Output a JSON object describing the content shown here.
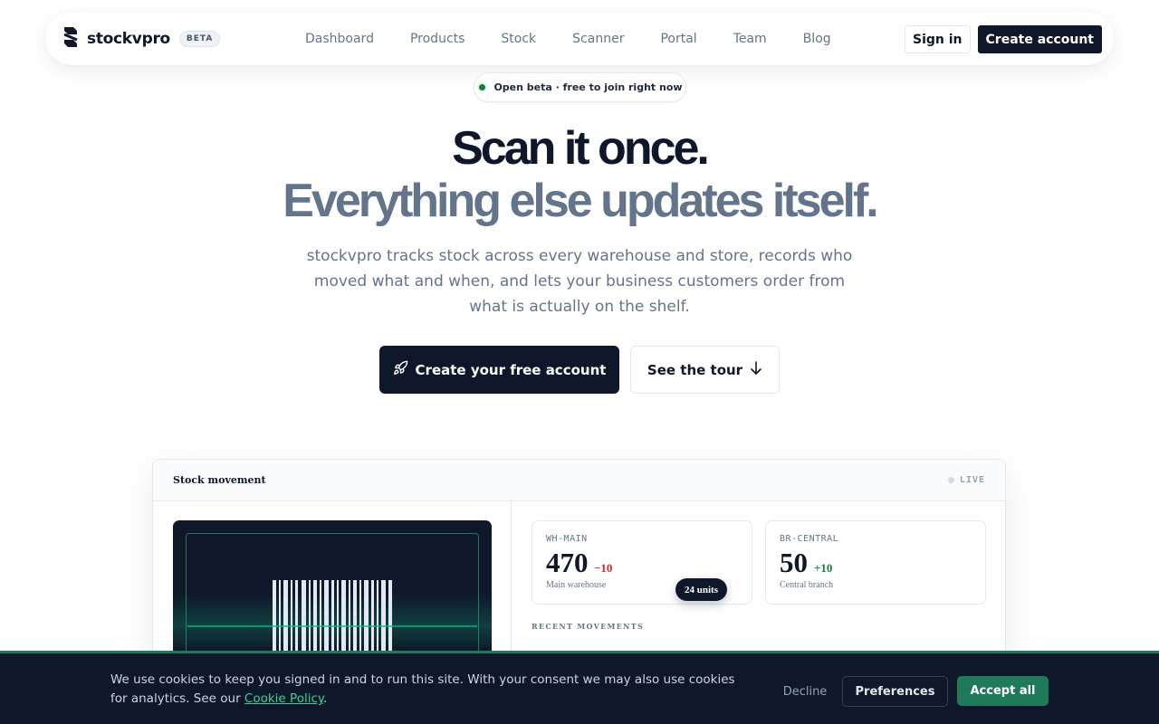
{
  "nav": {
    "brand": "stockvpro",
    "badge": "BETA",
    "links": [
      "Dashboard",
      "Products",
      "Stock",
      "Scanner",
      "Portal",
      "Team",
      "Blog"
    ],
    "sign_in": "Sign in",
    "create_account": "Create account"
  },
  "hero": {
    "pill": "Open beta · free to join right now",
    "headline_1": "Scan it once.",
    "headline_2": "Everything else updates itself.",
    "subtitle": "stockvpro tracks stock across every warehouse and store, records who moved what and when, and lets your business customers order from what is actually on the shelf.",
    "cta_primary": "Create your free account",
    "cta_secondary": "See the tour"
  },
  "preview": {
    "title": "Stock movement",
    "status": "LIVE",
    "stats": [
      {
        "code": "WH-MAIN",
        "value": "470",
        "delta": "−10",
        "label": "Main warehouse"
      },
      {
        "code": "BR-CENTRAL",
        "value": "50",
        "delta": "+10",
        "label": "Central branch"
      }
    ],
    "badge": "24 units",
    "recent_label": "RECENT MOVEMENTS"
  },
  "cookie": {
    "text": "We use cookies to keep you signed in and to run this site. With your consent we may also use cookies for analytics. See our ",
    "link": "Cookie Policy",
    "after": ".",
    "decline": "Decline",
    "preferences": "Preferences",
    "accept": "Accept all"
  },
  "colors": {
    "primary": "#0f172a",
    "muted": "#64748b",
    "accent_green": "#1f7a5c",
    "negative": "#dc2626",
    "positive": "#15803d"
  },
  "icons": {
    "logo": "stockvpro-logo-icon",
    "cta_primary": "rocket-icon",
    "cta_secondary": "arrow-down-icon"
  }
}
